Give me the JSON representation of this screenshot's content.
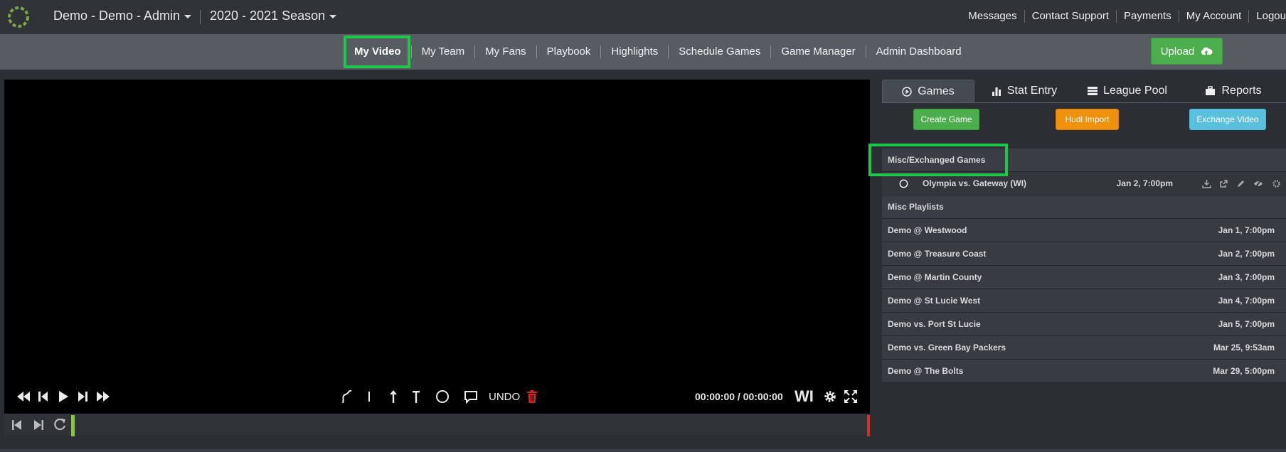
{
  "header": {
    "team_selector": "Demo - Demo - Admin",
    "season_selector": "2020 - 2021 Season",
    "links": [
      "Messages",
      "Contact Support",
      "Payments",
      "My Account",
      "Logou"
    ]
  },
  "nav": {
    "items": [
      "My Video",
      "My Team",
      "My Fans",
      "Playbook",
      "Highlights",
      "Schedule Games",
      "Game Manager",
      "Admin Dashboard"
    ],
    "active": "My Video",
    "upload_label": "Upload"
  },
  "player": {
    "timecode": "00:00:00 / 00:00:00",
    "undo_label": "UNDO",
    "state_label": "WI"
  },
  "panel": {
    "tabs": [
      "Games",
      "Stat Entry",
      "League Pool",
      "Reports"
    ],
    "active_tab": "Games",
    "buttons": {
      "create_game": "Create Game",
      "hudl_import": "Hudl Import",
      "exchange_video": "Exchange Video"
    },
    "misc_group_label": "Misc/Exchanged Games",
    "misc_game": {
      "name": "Olympia vs. Gateway (WI)",
      "date": "Jan 2, 7:00pm"
    },
    "misc_playlists_label": "Misc Playlists",
    "games": [
      {
        "name": "Demo @ Westwood",
        "date": "Jan 1, 7:00pm"
      },
      {
        "name": "Demo @ Treasure Coast",
        "date": "Jan 2, 7:00pm"
      },
      {
        "name": "Demo @ Martin County",
        "date": "Jan 3, 7:00pm"
      },
      {
        "name": "Demo @ St Lucie West",
        "date": "Jan 4, 7:00pm"
      },
      {
        "name": "Demo vs. Port St Lucie",
        "date": "Jan 5, 7:00pm"
      },
      {
        "name": "Demo vs. Green Bay Packers",
        "date": "Mar 25, 9:53am"
      },
      {
        "name": "Demo @ The Bolts",
        "date": "Mar 29, 5:00pm"
      }
    ]
  },
  "colors": {
    "highlight": "#1ec74a",
    "green_button": "#4cae4c",
    "orange_button": "#f0900f",
    "blue_button": "#5bc0de"
  }
}
